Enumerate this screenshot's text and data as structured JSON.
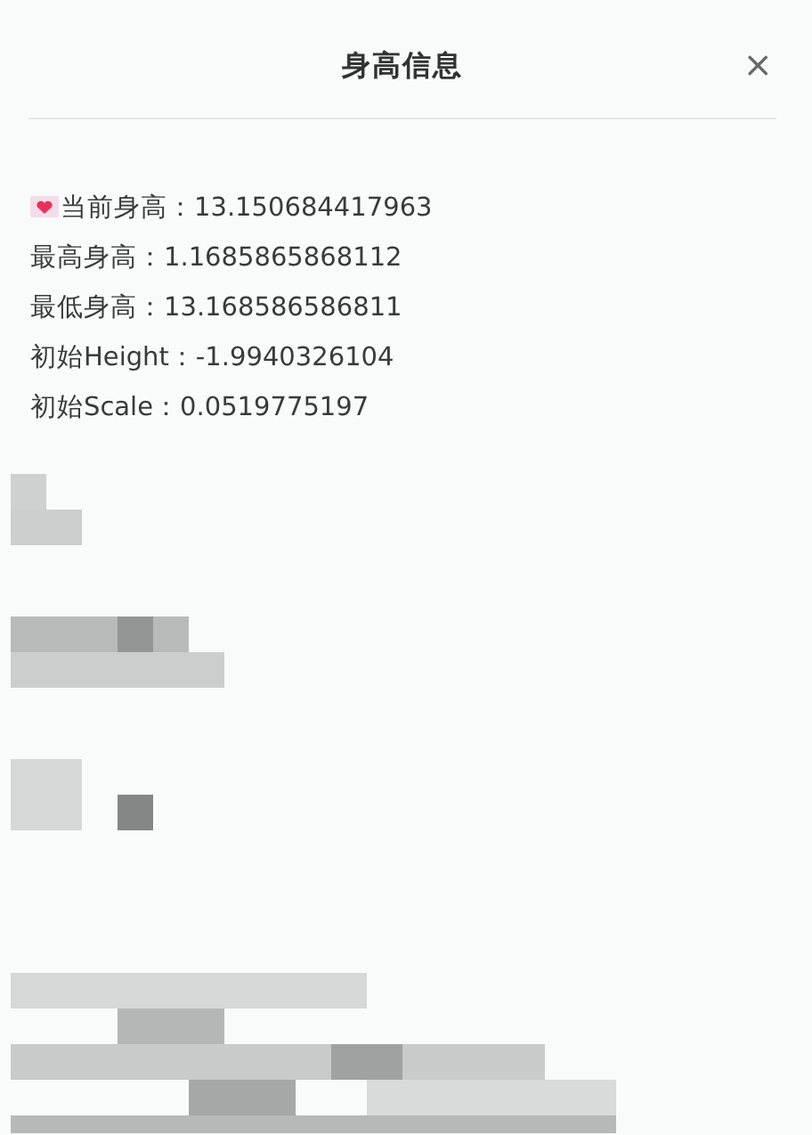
{
  "dialog": {
    "title": "身高信息",
    "close": "×"
  },
  "lines": [
    {
      "kind": "heart",
      "text": "当前身高：13.150684417963"
    },
    {
      "kind": "plain",
      "text": "最高身高：1.1685865868112"
    },
    {
      "kind": "plain",
      "text": "最低身高：13.168586586811"
    },
    {
      "kind": "plain",
      "text": "初始Height：-1.9940326104"
    },
    {
      "kind": "plain",
      "text": "初始Scale：0.0519775197"
    }
  ]
}
